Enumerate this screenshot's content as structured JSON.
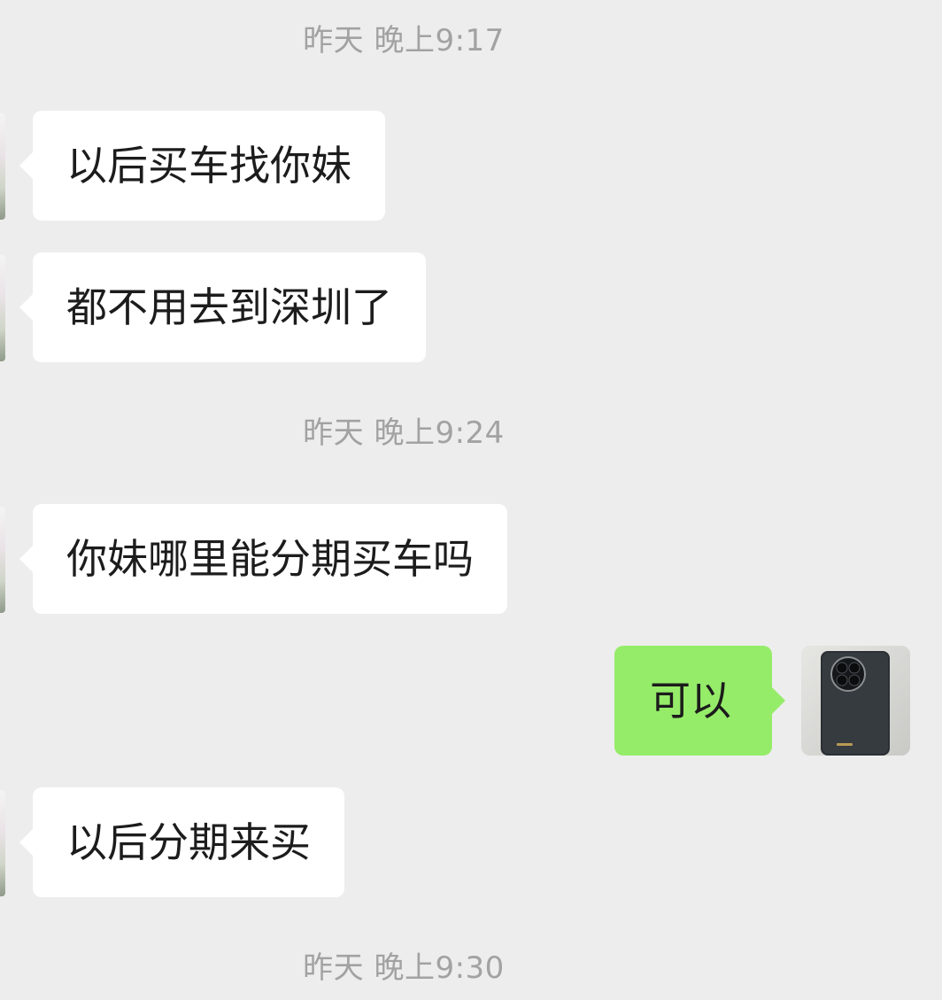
{
  "messages": [
    {
      "type": "time",
      "text": "昨天 晚上9:17"
    },
    {
      "type": "incoming",
      "text": "以后买车找你妹"
    },
    {
      "type": "incoming",
      "text": "都不用去到深圳了"
    },
    {
      "type": "time",
      "text": "昨天 晚上9:24"
    },
    {
      "type": "incoming",
      "text": "你妹哪里能分期买车吗"
    },
    {
      "type": "outgoing",
      "text": "可以"
    },
    {
      "type": "incoming",
      "text": "以后分期来买"
    },
    {
      "type": "time",
      "text": "昨天 晚上9:30"
    }
  ],
  "avatar": {
    "self_icon": "phone-photo-avatar"
  },
  "colors": {
    "background": "#ededed",
    "incoming_bubble": "#ffffff",
    "outgoing_bubble": "#95ec69",
    "timestamp_text": "#a2a2a2"
  }
}
